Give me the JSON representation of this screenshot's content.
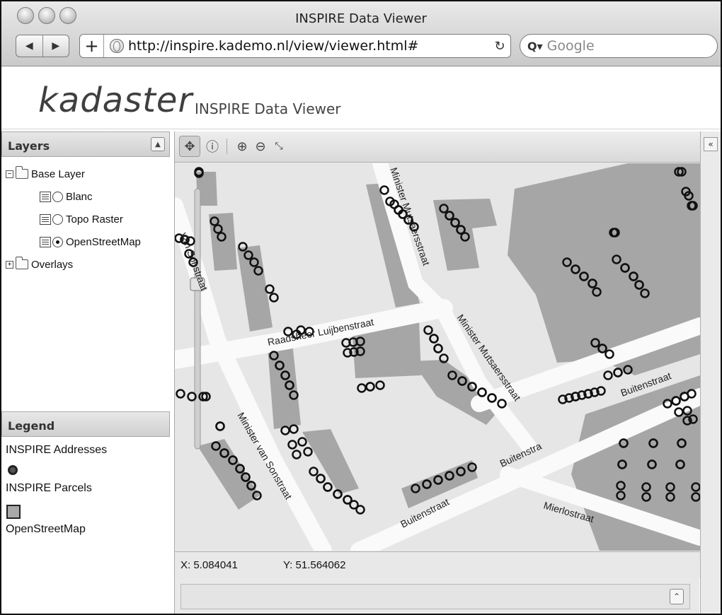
{
  "window": {
    "title": "INSPIRE Data Viewer"
  },
  "browser": {
    "back": "◀",
    "forward": "▶",
    "add": "+",
    "url": "http://inspire.kademo.nl/view/viewer.html#",
    "reload": "↻",
    "search_placeholder": "Google",
    "search_icon": "Q▾"
  },
  "header": {
    "logo": "kadaster",
    "subtitle": "INSPIRE Data Viewer"
  },
  "layers_panel": {
    "title": "Layers",
    "collapse": "▲",
    "tree": [
      {
        "toggle": "−",
        "label": "Base Layer"
      },
      {
        "label": "Blanc"
      },
      {
        "label": "Topo Raster"
      },
      {
        "label": "OpenStreetMap",
        "selected": true
      },
      {
        "toggle": "+",
        "label": "Overlays"
      }
    ]
  },
  "legend_panel": {
    "title": "Legend",
    "items": [
      "INSPIRE Addresses",
      "INSPIRE Parcels",
      "OpenStreetMap"
    ]
  },
  "toolbar": {
    "pan": "✥",
    "info": "ⓘ",
    "zoom_in": "⊕",
    "zoom_out": "⊖",
    "full_extent": "⤡"
  },
  "map": {
    "streets": [
      "Minister Mutsaersstraat",
      "Raadsheer Luijbenstraat",
      "Minister Mutsaersstraat",
      "Buitenstraat",
      "Buitenstra",
      "Buitenstraat",
      "Minister van Sonstraat",
      "Mierlostraat",
      "van Sonstraat"
    ],
    "zoom_level_fraction": 0.36
  },
  "status": {
    "x": "X: 5.084041",
    "y": "Y: 51.564062"
  },
  "bottom": {
    "expand": "⌃"
  },
  "right_panel": {
    "toggle": "«"
  }
}
